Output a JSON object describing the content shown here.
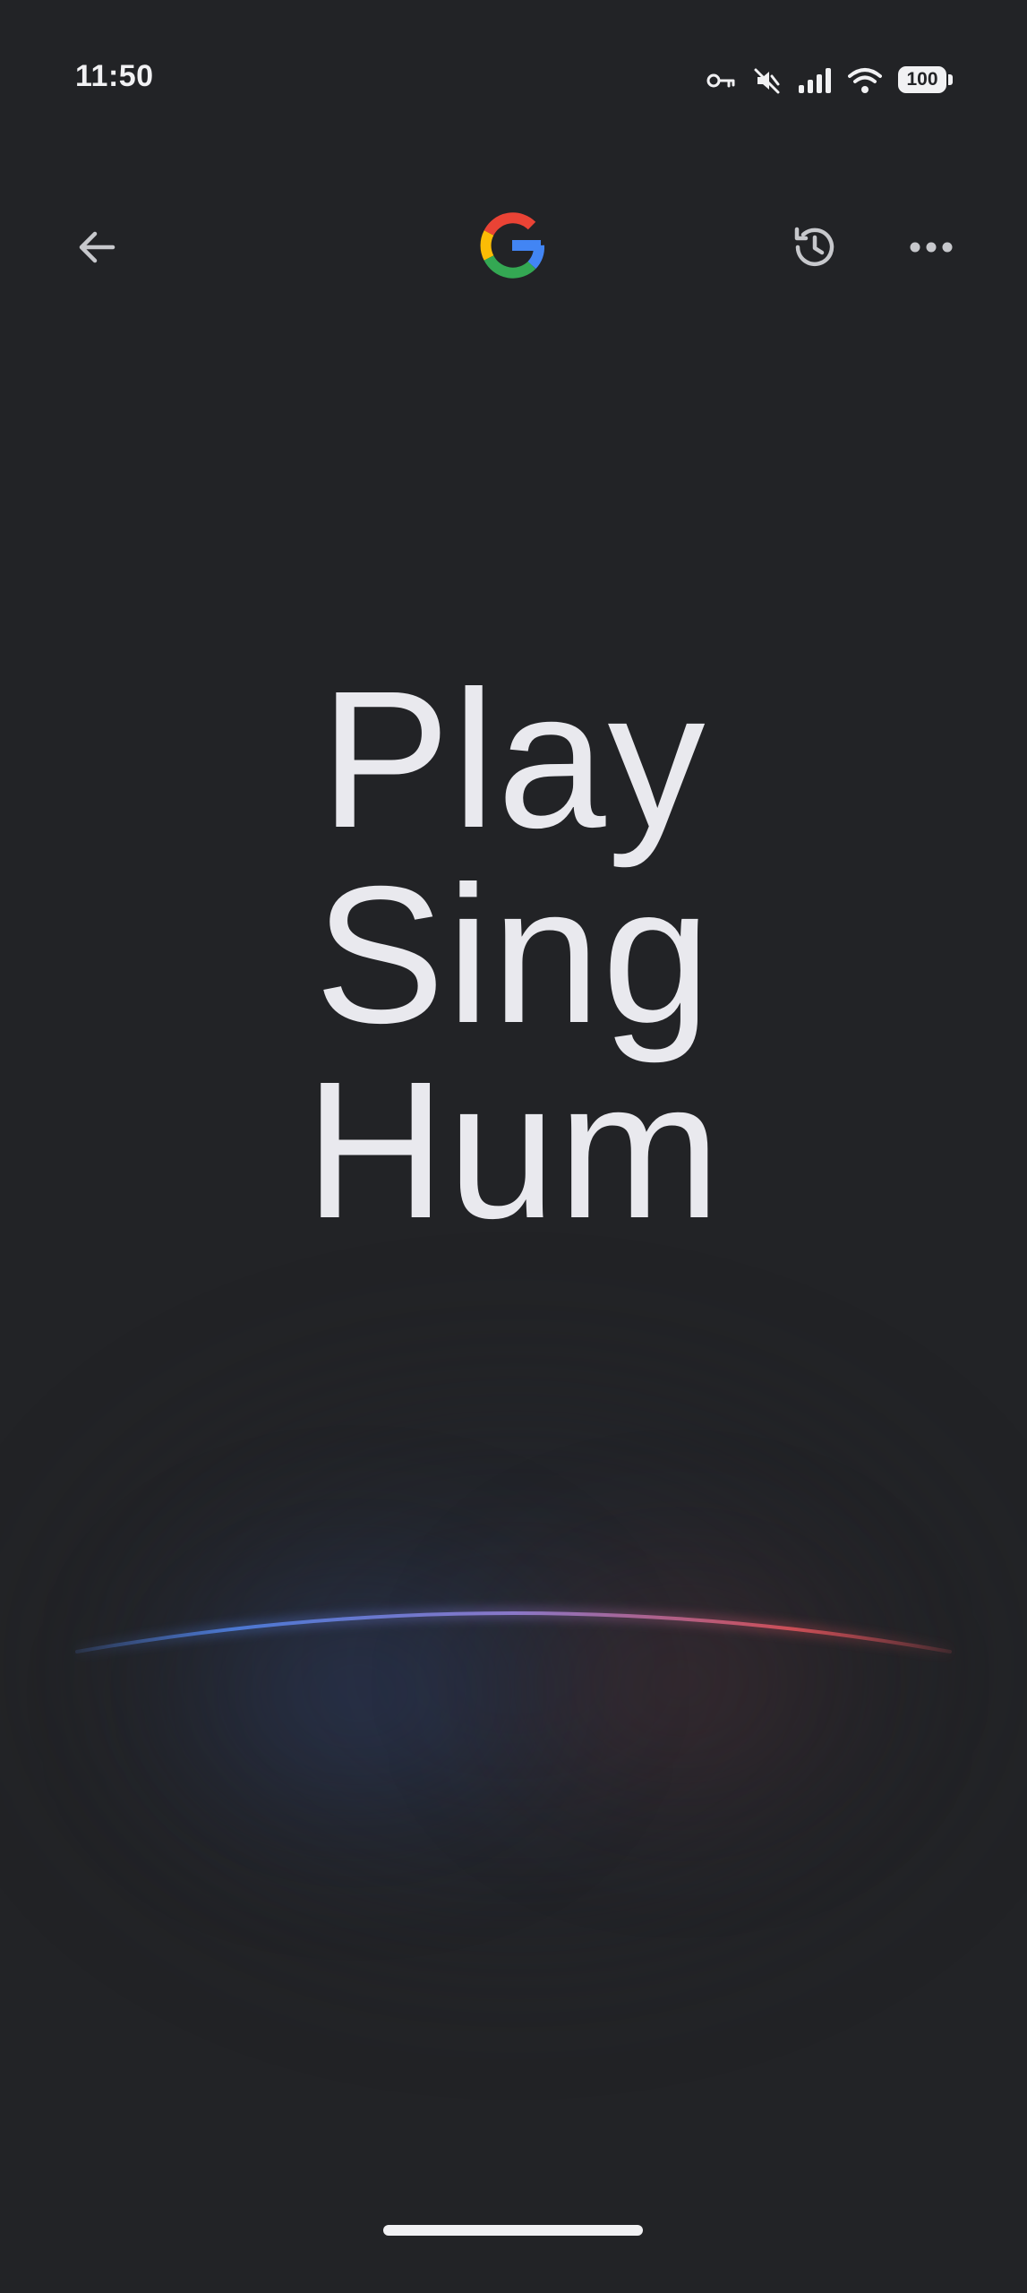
{
  "status_bar": {
    "time": "11:50",
    "battery_level": "100",
    "icons": [
      "vpn-key-icon",
      "mute-icon",
      "signal-icon",
      "wifi-icon",
      "battery-icon"
    ]
  },
  "app_bar": {
    "back_icon": "arrow-back-icon",
    "logo": "google-g-logo",
    "history_icon": "history-icon",
    "more_icon": "more-horizontal-icon"
  },
  "hero": {
    "line1": "Play",
    "line2": "Sing",
    "line3": "Hum"
  },
  "colors": {
    "background": "#222326",
    "text": "#e9e9ee",
    "arc_blue": "#4f7fe0",
    "arc_red": "#d9525a",
    "google_blue": "#4285F4",
    "google_red": "#EA4335",
    "google_yellow": "#FBBC05",
    "google_green": "#34A853"
  }
}
